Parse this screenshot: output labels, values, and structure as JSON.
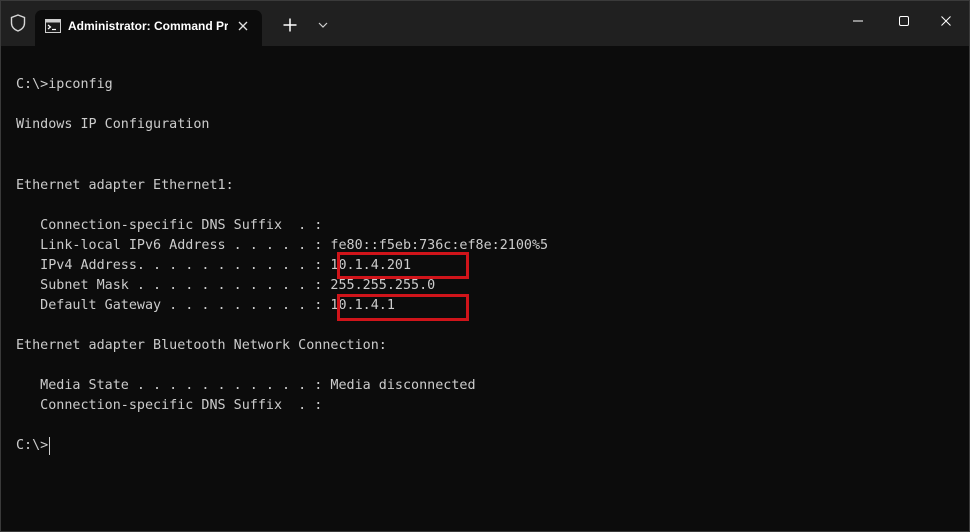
{
  "titlebar": {
    "tab_title": "Administrator: Command Prompt",
    "icons": {
      "shield": "shield-icon",
      "tab": "command-prompt-icon",
      "tab_close": "close-icon",
      "new_tab": "plus-icon",
      "dropdown": "chevron-down-icon",
      "minimize": "minimize-icon",
      "maximize": "maximize-icon",
      "close": "close-icon"
    }
  },
  "terminal": {
    "lines": [
      "C:\\>ipconfig",
      "Windows IP Configuration",
      "Ethernet adapter Ethernet1:",
      "   Connection-specific DNS Suffix  . :",
      "   Link-local IPv6 Address . . . . . : fe80::f5eb:736c:ef8e:2100%5",
      "   IPv4 Address. . . . . . . . . . . : 10.1.4.201",
      "   Subnet Mask . . . . . . . . . . . : 255.255.255.0",
      "   Default Gateway . . . . . . . . . : 10.1.4.1",
      "Ethernet adapter Bluetooth Network Connection:",
      "   Media State . . . . . . . . . . . : Media disconnected",
      "   Connection-specific DNS Suffix  . :",
      "C:\\>"
    ]
  },
  "colors": {
    "background": "#0c0c0c",
    "titlebar": "#202020",
    "text": "#cccccc",
    "highlight": "#d0141a"
  }
}
